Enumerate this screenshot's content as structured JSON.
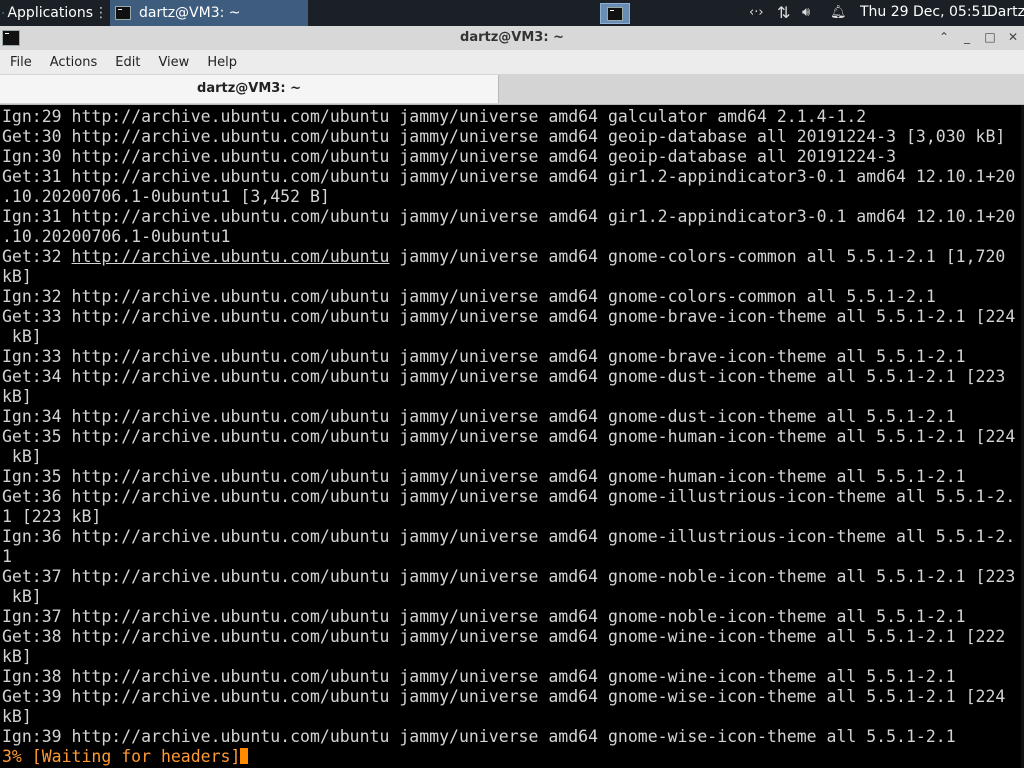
{
  "panel": {
    "applications_label": "Applications",
    "task_label": "dartz@VM3: ~",
    "clock": "Thu 29 Dec, 05:51",
    "user": "Dartz",
    "icons": [
      "network-icon",
      "transfer-icon",
      "volume-icon",
      "notification-bell-icon"
    ]
  },
  "window": {
    "title": "dartz@VM3: ~",
    "controls": [
      "minimize-up",
      "minimize",
      "maximize",
      "close"
    ]
  },
  "menubar": {
    "items": [
      "File",
      "Actions",
      "Edit",
      "View",
      "Help"
    ]
  },
  "tab": {
    "label": "dartz@VM3: ~"
  },
  "terminal": {
    "lines": [
      "Ign:29 http://archive.ubuntu.com/ubuntu jammy/universe amd64 galculator amd64 2.1.4-1.2",
      "Get:30 http://archive.ubuntu.com/ubuntu jammy/universe amd64 geoip-database all 20191224-3 [3,030 kB]",
      "Ign:30 http://archive.ubuntu.com/ubuntu jammy/universe amd64 geoip-database all 20191224-3",
      "Get:31 http://archive.ubuntu.com/ubuntu jammy/universe amd64 gir1.2-appindicator3-0.1 amd64 12.10.1+20",
      ".10.20200706.1-0ubuntu1 [3,452 B]",
      "Ign:31 http://archive.ubuntu.com/ubuntu jammy/universe amd64 gir1.2-appindicator3-0.1 amd64 12.10.1+20",
      ".10.20200706.1-0ubuntu1",
      "Get:32 http://archive.ubuntu.com/ubuntu jammy/universe amd64 gnome-colors-common all 5.5.1-2.1 [1,720",
      "kB]",
      "Ign:32 http://archive.ubuntu.com/ubuntu jammy/universe amd64 gnome-colors-common all 5.5.1-2.1",
      "Get:33 http://archive.ubuntu.com/ubuntu jammy/universe amd64 gnome-brave-icon-theme all 5.5.1-2.1 [224",
      " kB]",
      "Ign:33 http://archive.ubuntu.com/ubuntu jammy/universe amd64 gnome-brave-icon-theme all 5.5.1-2.1",
      "Get:34 http://archive.ubuntu.com/ubuntu jammy/universe amd64 gnome-dust-icon-theme all 5.5.1-2.1 [223",
      "kB]",
      "Ign:34 http://archive.ubuntu.com/ubuntu jammy/universe amd64 gnome-dust-icon-theme all 5.5.1-2.1",
      "Get:35 http://archive.ubuntu.com/ubuntu jammy/universe amd64 gnome-human-icon-theme all 5.5.1-2.1 [224",
      " kB]",
      "Ign:35 http://archive.ubuntu.com/ubuntu jammy/universe amd64 gnome-human-icon-theme all 5.5.1-2.1",
      "Get:36 http://archive.ubuntu.com/ubuntu jammy/universe amd64 gnome-illustrious-icon-theme all 5.5.1-2.",
      "1 [223 kB]",
      "Ign:36 http://archive.ubuntu.com/ubuntu jammy/universe amd64 gnome-illustrious-icon-theme all 5.5.1-2.",
      "1",
      "Get:37 http://archive.ubuntu.com/ubuntu jammy/universe amd64 gnome-noble-icon-theme all 5.5.1-2.1 [223",
      " kB]",
      "Ign:37 http://archive.ubuntu.com/ubuntu jammy/universe amd64 gnome-noble-icon-theme all 5.5.1-2.1",
      "Get:38 http://archive.ubuntu.com/ubuntu jammy/universe amd64 gnome-wine-icon-theme all 5.5.1-2.1 [222",
      "kB]",
      "Ign:38 http://archive.ubuntu.com/ubuntu jammy/universe amd64 gnome-wine-icon-theme all 5.5.1-2.1",
      "Get:39 http://archive.ubuntu.com/ubuntu jammy/universe amd64 gnome-wise-icon-theme all 5.5.1-2.1 [224",
      "kB]",
      "Ign:39 http://archive.ubuntu.com/ubuntu jammy/universe amd64 gnome-wise-icon-theme all 5.5.1-2.1"
    ],
    "hovered_link": {
      "line": 7,
      "prefix": "Get:32 ",
      "url": "http://archive.ubuntu.com/ubuntu",
      "suffix": " jammy/universe amd64 gnome-colors-common all 5.5.1-2.1 [1,720"
    },
    "progress": "3% [Waiting for headers]",
    "progress_color": "#ff9933"
  }
}
